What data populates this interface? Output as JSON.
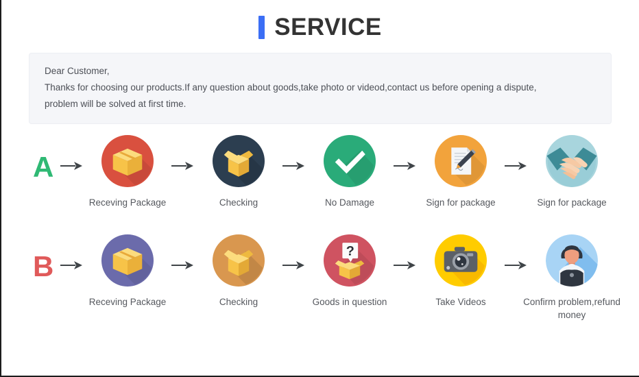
{
  "header": {
    "accent_color": "#3b6ef5",
    "title": "SERVICE"
  },
  "notice": {
    "background_color": "#f5f6f9",
    "line1": "Dear Customer,",
    "line2": "Thanks for choosing our products.If any question about goods,take photo or videod,contact us before opening a dispute,",
    "line3": "problem will be solved at first time."
  },
  "arrow": {
    "icon": "arrow-right-icon",
    "color": "#3f4448"
  },
  "rows": [
    {
      "letter": "A",
      "letter_color": "#2fb974",
      "steps": [
        {
          "label": "Receving Package",
          "icon": "closed-box-icon",
          "circle_color": "#d9503f",
          "box_color": "#f7cd5f"
        },
        {
          "label": "Checking",
          "icon": "open-box-icon",
          "circle_color": "#2c3e50",
          "box_color": "#f6c95a"
        },
        {
          "label": "No Damage",
          "icon": "check-mark-icon",
          "circle_color": "#2aab79",
          "mark_color": "#ffffff"
        },
        {
          "label": "Sign for package",
          "icon": "document-pen-icon",
          "circle_color": "#f2a33c",
          "paper_color": "#f4f6f8"
        },
        {
          "label": "Sign for package",
          "icon": "handshake-icon",
          "circle_color": "#a8d5dd",
          "sleeve_color": "#3d8b96",
          "skin_color": "#f6c9a4"
        }
      ]
    },
    {
      "letter": "B",
      "letter_color": "#e05a5a",
      "steps": [
        {
          "label": "Receving Package",
          "icon": "closed-box-icon",
          "circle_color": "#6b6bab",
          "box_color": "#f7cd5f"
        },
        {
          "label": "Checking",
          "icon": "open-box-icon",
          "circle_color": "#d9974f",
          "box_color": "#f6c95a"
        },
        {
          "label": "Goods in question",
          "icon": "question-box-icon",
          "circle_color": "#cf5361",
          "box_color": "#f6c95a",
          "bubble_color": "#fbfbfb",
          "question_mark": "?"
        },
        {
          "label": "Take Videos",
          "icon": "camera-icon",
          "circle_color": "#ffcc00",
          "camera_color": "#5b6067"
        },
        {
          "label": "Confirm problem,refund money",
          "icon": "person-avatar-icon",
          "circle_color": "#a8d4f5",
          "hair_color": "#2f3640",
          "skin_color": "#ef9e7e",
          "suit_color": "#2f3640"
        }
      ]
    }
  ]
}
